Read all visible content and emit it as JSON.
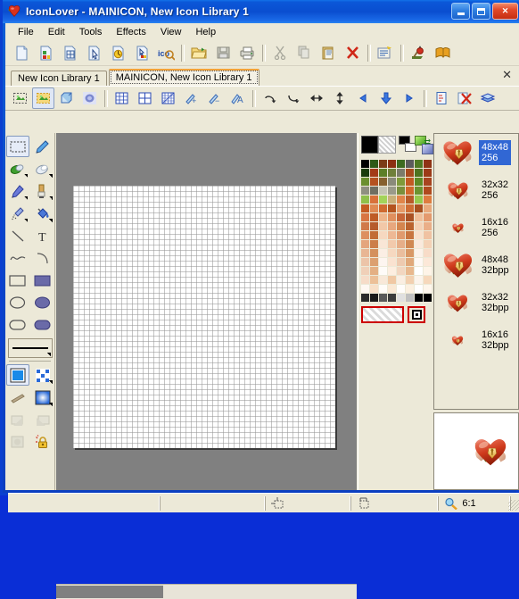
{
  "window": {
    "title": "IconLover - MAINICON, New Icon Library 1",
    "app_icon": "heart-icon",
    "buttons": {
      "minimize": "minimize-button",
      "maximize": "maximize-button",
      "close": "close-button"
    }
  },
  "menubar": {
    "items": [
      "File",
      "Edit",
      "Tools",
      "Effects",
      "View",
      "Help"
    ]
  },
  "toolbar_main": {
    "items": [
      {
        "name": "new-icon",
        "glyph": "new"
      },
      {
        "name": "new-icon-library",
        "glyph": "newlib"
      },
      {
        "name": "new-image",
        "glyph": "newimg"
      },
      {
        "name": "new-cursor",
        "glyph": "cursor"
      },
      {
        "name": "new-animated-cursor",
        "glyph": "anicur"
      },
      {
        "name": "import-image",
        "glyph": "importimg"
      },
      {
        "name": "extract-icons",
        "glyph": "ico"
      },
      {
        "name": "open-file",
        "glyph": "open"
      },
      {
        "name": "save-file",
        "glyph": "save"
      },
      {
        "name": "print",
        "glyph": "print"
      },
      {
        "name": "cut",
        "glyph": "cut"
      },
      {
        "name": "copy",
        "glyph": "copy"
      },
      {
        "name": "paste",
        "glyph": "paste"
      },
      {
        "name": "delete",
        "glyph": "delete"
      },
      {
        "name": "properties",
        "glyph": "props"
      },
      {
        "name": "explore",
        "glyph": "explore"
      },
      {
        "name": "help-book",
        "glyph": "book"
      }
    ]
  },
  "tabs": {
    "items": [
      {
        "label": "New Icon Library 1",
        "active": false
      },
      {
        "label": "MAINICON, New Icon Library 1",
        "active": true
      }
    ],
    "close_label": "✕"
  },
  "toolbar_edit": {
    "items": [
      {
        "name": "select-transparent",
        "glyph": "seltrans",
        "active": false
      },
      {
        "name": "select-opaque",
        "glyph": "selop",
        "active": true
      },
      {
        "name": "draw-3d",
        "glyph": "cube",
        "active": false
      },
      {
        "name": "smooth",
        "glyph": "blur",
        "active": false
      },
      {
        "name": "grid-normal",
        "glyph": "grid1",
        "active": false
      },
      {
        "name": "grid-coarse",
        "glyph": "grid2",
        "active": false
      },
      {
        "name": "grid-pixel",
        "glyph": "grid3",
        "active": false
      },
      {
        "name": "zoom-in",
        "glyph": "zoomin",
        "active": false
      },
      {
        "name": "zoom-out",
        "glyph": "zoomout",
        "active": false
      },
      {
        "name": "antialias-text",
        "glyph": "aatext",
        "active": false
      },
      {
        "name": "rotate-left",
        "glyph": "rotl",
        "active": false
      },
      {
        "name": "rotate-right",
        "glyph": "rotr",
        "active": false
      },
      {
        "name": "flip-horizontal",
        "glyph": "fliph",
        "active": false
      },
      {
        "name": "flip-vertical",
        "glyph": "flipv",
        "active": false
      },
      {
        "name": "shift-left",
        "glyph": "shl",
        "active": false
      },
      {
        "name": "shift-down",
        "glyph": "shd",
        "active": false
      },
      {
        "name": "shift-right",
        "glyph": "shr",
        "active": false
      },
      {
        "name": "image-properties",
        "glyph": "imgprops",
        "active": false
      },
      {
        "name": "delete-image",
        "glyph": "delimg",
        "active": false
      },
      {
        "name": "layers",
        "glyph": "layers",
        "active": false
      }
    ]
  },
  "tool_palette": {
    "rows": [
      [
        {
          "name": "select-rectangle",
          "glyph": "marquee",
          "selected": true
        },
        {
          "name": "pencil",
          "glyph": "pencil",
          "selected": false
        }
      ],
      [
        {
          "name": "eraser-color",
          "glyph": "eraser-green",
          "selected": false,
          "more": true
        },
        {
          "name": "eraser",
          "glyph": "eraser",
          "selected": false,
          "more": true
        }
      ],
      [
        {
          "name": "marker",
          "glyph": "marker",
          "selected": false,
          "more": true
        },
        {
          "name": "brush",
          "glyph": "brush",
          "selected": false,
          "more": true
        }
      ],
      [
        {
          "name": "airbrush",
          "glyph": "airbrush",
          "selected": false,
          "more": true
        },
        {
          "name": "paint-bucket",
          "glyph": "bucket",
          "selected": false,
          "more": true
        }
      ],
      [
        {
          "name": "line",
          "glyph": "line",
          "selected": false
        },
        {
          "name": "text",
          "glyph": "text",
          "selected": false
        }
      ],
      [
        {
          "name": "curve",
          "glyph": "curve",
          "selected": false
        },
        {
          "name": "arc",
          "glyph": "arc",
          "selected": false
        }
      ],
      [
        {
          "name": "rectangle-outline",
          "glyph": "rect",
          "selected": false
        },
        {
          "name": "rectangle-filled",
          "glyph": "rectfill",
          "selected": false
        }
      ],
      [
        {
          "name": "ellipse-outline",
          "glyph": "ellipse",
          "selected": false
        },
        {
          "name": "ellipse-filled",
          "glyph": "ellipsefill",
          "selected": false
        }
      ],
      [
        {
          "name": "rounded-rect-outline",
          "glyph": "rrect",
          "selected": false
        },
        {
          "name": "rounded-rect-filled",
          "glyph": "rrectfill",
          "selected": false
        }
      ]
    ],
    "line_width_selector": "line-width-selector",
    "rows2": [
      [
        {
          "name": "fill-style-solid",
          "glyph": "solid",
          "selected": true
        },
        {
          "name": "fill-style-pattern",
          "glyph": "pattern",
          "selected": false,
          "more": true
        }
      ],
      [
        {
          "name": "gradient-linear",
          "glyph": "gradline",
          "selected": false
        },
        {
          "name": "gradient-radial",
          "glyph": "gradrad",
          "selected": false,
          "more": true
        }
      ],
      [
        {
          "name": "shadow-left",
          "glyph": "shadowl",
          "selected": false,
          "disabled": true
        },
        {
          "name": "shadow-right",
          "glyph": "shadowr",
          "selected": false,
          "disabled": true
        }
      ],
      [
        {
          "name": "emboss",
          "glyph": "emboss",
          "selected": false,
          "disabled": true
        },
        {
          "name": "lock-transparency",
          "glyph": "lock",
          "selected": false
        }
      ]
    ]
  },
  "color_palette": {
    "foreground": "#000000",
    "background": "#FFFFFF",
    "transparent_label": "transparent-swatch",
    "swatches": [
      "#000000",
      "#2e5a16",
      "#7b3b17",
      "#8c2f12",
      "#3d6b20",
      "#5c5c5c",
      "#4f7a22",
      "#8f3315",
      "#1a3c0c",
      "#a33b16",
      "#5d7f28",
      "#6f7f3a",
      "#7b7b6b",
      "#a84a1e",
      "#4e7320",
      "#9c3a18",
      "#6b8f2e",
      "#b5521f",
      "#86612f",
      "#8a8a7a",
      "#7f9a3a",
      "#c25a22",
      "#5e8a24",
      "#a84420",
      "#8f8f80",
      "#6f6f62",
      "#c4c4b4",
      "#9a9a8a",
      "#7a8f3c",
      "#d1682b",
      "#6b9430",
      "#b04a1e",
      "#8fbf4a",
      "#d9713a",
      "#a3d35a",
      "#c8b07a",
      "#e0854a",
      "#b85a28",
      "#97c84e",
      "#de7c3f",
      "#c45a22",
      "#e08a52",
      "#d06a30",
      "#b4541f",
      "#e59a68",
      "#cf6d34",
      "#a8501f",
      "#e8a97c",
      "#d87542",
      "#bf5c26",
      "#eeb48a",
      "#e08f5e",
      "#c76638",
      "#aa5224",
      "#f0bf9a",
      "#e49a6e",
      "#d07a4a",
      "#b65c2c",
      "#f2c8a8",
      "#e8a77e",
      "#d4854f",
      "#ba632f",
      "#f4d0b4",
      "#eaae88",
      "#dd9060",
      "#c26c36",
      "#f6d8c0",
      "#eeb894",
      "#e09a6e",
      "#c87540",
      "#f8e0cc",
      "#f0c2a2",
      "#e4a57c",
      "#cc7e4a",
      "#f9e6d6",
      "#f2caac",
      "#e6ae88",
      "#d08852",
      "#fae9dc",
      "#f4d2b6",
      "#e8b694",
      "#d4905c",
      "#fbeee4",
      "#f6d8c0",
      "#eabe9e",
      "#d89866",
      "#fcf2ea",
      "#f8dcc8",
      "#ecc4a8",
      "#dca070",
      "#fdf5f0",
      "#fae2d0",
      "#eecab0",
      "#e0a87a",
      "#fef8f4",
      "#fce8d8",
      "#f0d0b8",
      "#e4b084",
      "#fefbf8",
      "#fdeee0",
      "#f2d6c0",
      "#e8b88e",
      "#ffffff",
      "#fef4e8",
      "#f6dcc8",
      "#ecc098",
      "#f8e8d8",
      "#f0c8a4",
      "#faeee2",
      "#f2d0b0",
      "#fcf4ec",
      "#f6d8bc",
      "#fef8f2",
      "#f8e0c8",
      "#fffcf8",
      "#fae8d4",
      "#fffdfb",
      "#fcf0e0",
      "#ffffff",
      "#fef6ec",
      "#2b2b2b",
      "#1a1a1a",
      "#5a5a5a",
      "#3c3c3c",
      "#e0e0e0",
      "#c0c0c0",
      "#000000",
      "#000000"
    ]
  },
  "icon_list": {
    "items": [
      {
        "size": "48x48",
        "depth": "256",
        "selected": true,
        "thumb": "large"
      },
      {
        "size": "32x32",
        "depth": "256",
        "selected": false,
        "thumb": "medium"
      },
      {
        "size": "16x16",
        "depth": "256",
        "selected": false,
        "thumb": "small"
      },
      {
        "size": "48x48",
        "depth": "32bpp",
        "selected": false,
        "thumb": "large"
      },
      {
        "size": "32x32",
        "depth": "32bpp",
        "selected": false,
        "thumb": "medium"
      },
      {
        "size": "16x16",
        "depth": "32bpp",
        "selected": false,
        "thumb": "small"
      }
    ]
  },
  "preview_panel": {
    "name": "icon-preview"
  },
  "status_bar": {
    "panels": [
      {
        "name": "status-message",
        "text": ""
      },
      {
        "name": "cursor-position",
        "text": ""
      },
      {
        "name": "selection-size",
        "text": ""
      },
      {
        "name": "image-size-indicator",
        "text": ""
      },
      {
        "name": "zoom-level",
        "text": "6:1",
        "icon": "magnifier-icon"
      }
    ]
  },
  "canvas": {
    "name": "icon-edit-canvas",
    "grid_visible": true,
    "artwork": "heart-with-pencil-icon"
  }
}
